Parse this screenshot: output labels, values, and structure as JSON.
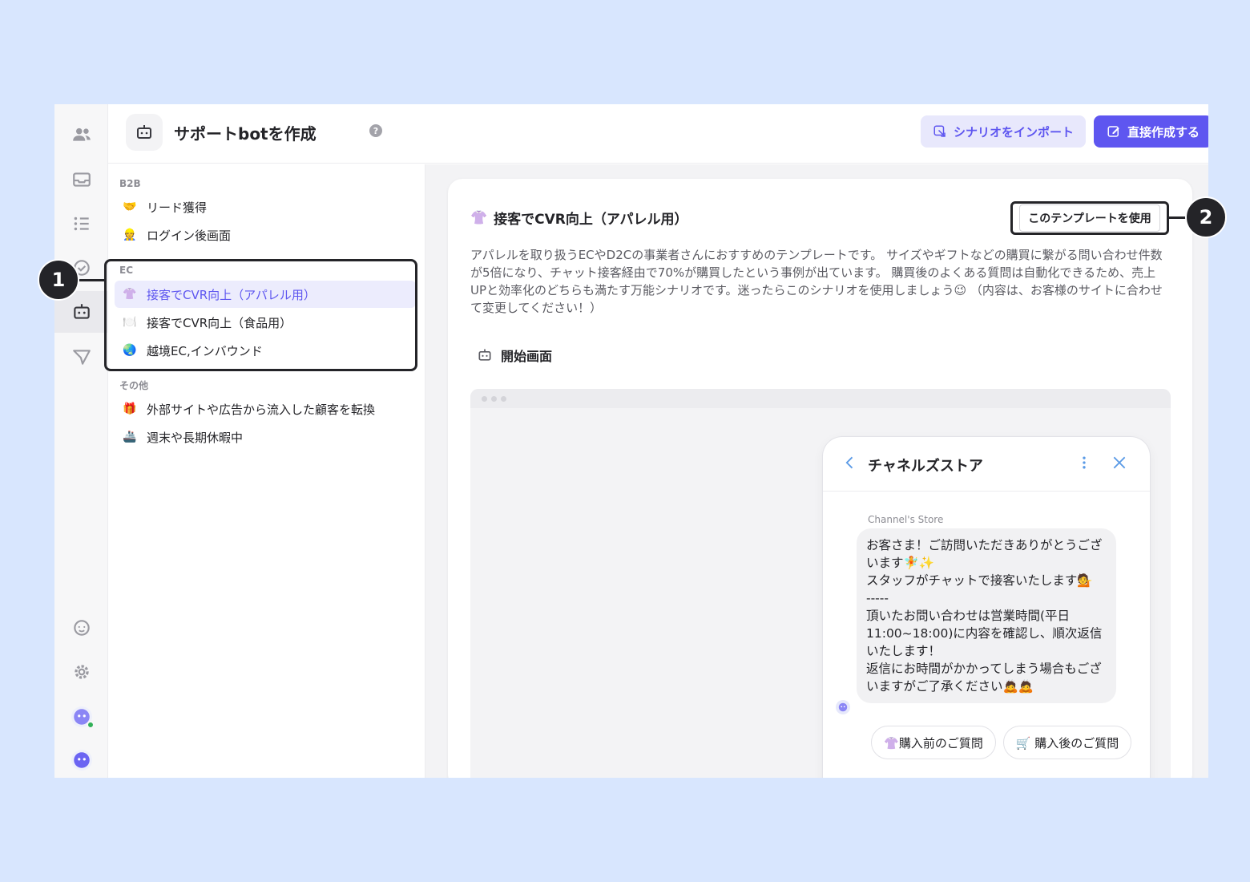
{
  "header": {
    "title": "サポートbotを作成",
    "import_label": "シナリオをインポート",
    "create_label": "直接作成する"
  },
  "template_list": {
    "sections": [
      {
        "label": "B2B",
        "items": [
          {
            "emoji": "🤝",
            "label": "リード獲得"
          },
          {
            "emoji": "👷",
            "label": "ログイン後画面"
          }
        ]
      },
      {
        "label": "EC",
        "items": [
          {
            "emoji": "👚",
            "label": "接客でCVR向上（アパレル用）",
            "selected": true
          },
          {
            "emoji": "🍽️",
            "label": "接客でCVR向上（食品用）"
          },
          {
            "emoji": "🌏",
            "label": "越境EC,インバウンド"
          }
        ]
      },
      {
        "label": "その他",
        "items": [
          {
            "emoji": "🎁",
            "label": "外部サイトや広告から流入した顧客を転換"
          },
          {
            "emoji": "🚢",
            "label": "週末や長期休暇中"
          }
        ]
      }
    ]
  },
  "detail": {
    "emoji": "👚",
    "title": "接客でCVR向上（アパレル用）",
    "use_template_label": "このテンプレートを使用",
    "description": "アパレルを取り扱うECやD2Cの事業者さんにおすすめのテンプレートです。 サイズやギフトなどの購買に繋がる問い合わせ件数が5倍になり、チャット接客経由で70%が購買したという事例が出ています。 購買後のよくある質問は自動化できるため、売上UPと効率化のどちらも満たす万能シナリオです。迷ったらこのシナリオを使用しましょう😉 （内容は、お客様のサイトに合わせて変更してください！）",
    "start_screen_label": "開始画面"
  },
  "messenger": {
    "title": "チャネルズストア",
    "sender": "Channel's Store",
    "message": "お客さま！ご訪問いただきありがとうございます🧚✨\nスタッフがチャットで接客いたします💁\n-----\n頂いたお問い合わせは営業時間(平日11:00~18:00)に内容を確認し、順次返信いたします！\n返信にお時間がかかってしまう場合もございますがご了承ください🙇🙇",
    "quick_replies": [
      "👚購入前のご質問",
      "🛒 購入後のご質問"
    ]
  },
  "callouts": [
    "1",
    "2"
  ],
  "colors": {
    "background": "#d8e6fe",
    "accent": "#5e56f0",
    "accent_light": "#e8e8fc"
  }
}
